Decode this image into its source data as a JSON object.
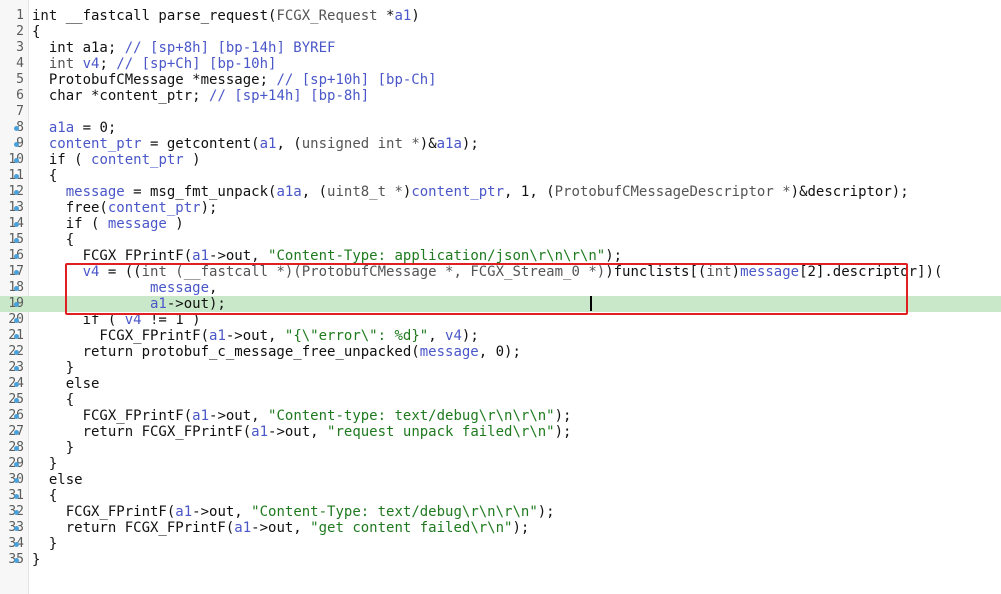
{
  "editor": {
    "highlighted_line": 19,
    "breakpoint_lines": [
      8,
      9,
      10,
      11,
      12,
      13,
      14,
      15,
      16,
      17,
      18,
      19,
      20,
      21,
      22,
      23,
      24,
      25,
      26,
      27,
      28,
      29,
      30,
      31,
      32,
      33,
      34,
      35
    ],
    "lines": [
      {
        "n": "1",
        "tokens": [
          [
            "kw",
            "int "
          ],
          [
            "txt",
            "__fastcall parse_request("
          ],
          [
            "type",
            "FCGX_Request"
          ],
          [
            "txt",
            " *"
          ],
          [
            "var",
            "a1"
          ],
          [
            "txt",
            ")"
          ]
        ]
      },
      {
        "n": "2",
        "tokens": [
          [
            "txt",
            "{"
          ]
        ]
      },
      {
        "n": "3",
        "tokens": [
          [
            "txt",
            "  int "
          ],
          [
            "txt",
            "a1a"
          ],
          [
            "txt",
            "; "
          ],
          [
            "cm",
            "// [sp+8h] [bp-14h] BYREF"
          ]
        ]
      },
      {
        "n": "4",
        "tokens": [
          [
            "type",
            "  int "
          ],
          [
            "var",
            "v4"
          ],
          [
            "txt",
            "; "
          ],
          [
            "cm",
            "// [sp+Ch] [bp-10h]"
          ]
        ]
      },
      {
        "n": "5",
        "tokens": [
          [
            "txt",
            "  ProtobufCMessage *message; "
          ],
          [
            "cm",
            "// [sp+10h] [bp-Ch]"
          ]
        ]
      },
      {
        "n": "6",
        "tokens": [
          [
            "txt",
            "  char *content_ptr; "
          ],
          [
            "cm",
            "// [sp+14h] [bp-8h]"
          ]
        ]
      },
      {
        "n": "7",
        "tokens": [
          [
            "txt",
            ""
          ]
        ]
      },
      {
        "n": "8",
        "tokens": [
          [
            "var",
            "  a1a"
          ],
          [
            "txt",
            " = 0;"
          ]
        ]
      },
      {
        "n": "9",
        "tokens": [
          [
            "var",
            "  content_ptr"
          ],
          [
            "txt",
            " = getcontent("
          ],
          [
            "var",
            "a1"
          ],
          [
            "txt",
            ", ("
          ],
          [
            "type",
            "unsigned int *"
          ],
          [
            "txt",
            ")&"
          ],
          [
            "var",
            "a1a"
          ],
          [
            "txt",
            ");"
          ]
        ]
      },
      {
        "n": "10",
        "tokens": [
          [
            "txt",
            "  if ( "
          ],
          [
            "var",
            "content_ptr"
          ],
          [
            "txt",
            " )"
          ]
        ]
      },
      {
        "n": "11",
        "tokens": [
          [
            "txt",
            "  {"
          ]
        ]
      },
      {
        "n": "12",
        "tokens": [
          [
            "var",
            "    message"
          ],
          [
            "txt",
            " = msg_fmt_unpack("
          ],
          [
            "var",
            "a1a"
          ],
          [
            "txt",
            ", ("
          ],
          [
            "type",
            "uint8_t *"
          ],
          [
            "txt",
            ")"
          ],
          [
            "var",
            "content_ptr"
          ],
          [
            "txt",
            ", 1, ("
          ],
          [
            "type",
            "ProtobufCMessageDescriptor *"
          ],
          [
            "txt",
            ")&descriptor);"
          ]
        ]
      },
      {
        "n": "13",
        "tokens": [
          [
            "txt",
            "    free("
          ],
          [
            "var",
            "content_ptr"
          ],
          [
            "txt",
            ");"
          ]
        ]
      },
      {
        "n": "14",
        "tokens": [
          [
            "txt",
            "    if ( "
          ],
          [
            "var",
            "message"
          ],
          [
            "txt",
            " )"
          ]
        ]
      },
      {
        "n": "15",
        "tokens": [
          [
            "txt",
            "    {"
          ]
        ]
      },
      {
        "n": "16",
        "tokens": [
          [
            "txt",
            "      FCGX_FPrintF("
          ],
          [
            "var",
            "a1"
          ],
          [
            "txt",
            "->out, "
          ],
          [
            "str",
            "\"Content-Type: application/json\\r\\n\\r\\n\""
          ],
          [
            "txt",
            ");"
          ]
        ]
      },
      {
        "n": "17",
        "tokens": [
          [
            "var",
            "      v4"
          ],
          [
            "txt",
            " = (("
          ],
          [
            "type",
            "int (__fastcall *)(ProtobufCMessage *, FCGX_Stream_0 *)"
          ],
          [
            "txt",
            ")funclists[("
          ],
          [
            "type",
            "int"
          ],
          [
            "txt",
            ")"
          ],
          [
            "var",
            "message"
          ],
          [
            "txt",
            "[2].descriptor])("
          ]
        ]
      },
      {
        "n": "18",
        "tokens": [
          [
            "var",
            "              message"
          ],
          [
            "txt",
            ","
          ]
        ]
      },
      {
        "n": "19",
        "tokens": [
          [
            "var",
            "              a1"
          ],
          [
            "txt",
            "->out);"
          ]
        ]
      },
      {
        "n": "20",
        "tokens": [
          [
            "txt",
            "      if ( "
          ],
          [
            "var",
            "v4"
          ],
          [
            "txt",
            " != 1 )"
          ]
        ]
      },
      {
        "n": "21",
        "tokens": [
          [
            "txt",
            "        FCGX_FPrintF("
          ],
          [
            "var",
            "a1"
          ],
          [
            "txt",
            "->out, "
          ],
          [
            "str",
            "\"{\\\"error\\\": %d}\""
          ],
          [
            "txt",
            ", "
          ],
          [
            "var",
            "v4"
          ],
          [
            "txt",
            ");"
          ]
        ]
      },
      {
        "n": "22",
        "tokens": [
          [
            "txt",
            "      return protobuf_c_message_free_unpacked("
          ],
          [
            "var",
            "message"
          ],
          [
            "txt",
            ", 0);"
          ]
        ]
      },
      {
        "n": "23",
        "tokens": [
          [
            "txt",
            "    }"
          ]
        ]
      },
      {
        "n": "24",
        "tokens": [
          [
            "txt",
            "    else"
          ]
        ]
      },
      {
        "n": "25",
        "tokens": [
          [
            "txt",
            "    {"
          ]
        ]
      },
      {
        "n": "26",
        "tokens": [
          [
            "txt",
            "      FCGX_FPrintF("
          ],
          [
            "var",
            "a1"
          ],
          [
            "txt",
            "->out, "
          ],
          [
            "str",
            "\"Content-type: text/debug\\r\\n\\r\\n\""
          ],
          [
            "txt",
            ");"
          ]
        ]
      },
      {
        "n": "27",
        "tokens": [
          [
            "txt",
            "      return FCGX_FPrintF("
          ],
          [
            "var",
            "a1"
          ],
          [
            "txt",
            "->out, "
          ],
          [
            "str",
            "\"request unpack failed\\r\\n\""
          ],
          [
            "txt",
            ");"
          ]
        ]
      },
      {
        "n": "28",
        "tokens": [
          [
            "txt",
            "    }"
          ]
        ]
      },
      {
        "n": "29",
        "tokens": [
          [
            "txt",
            "  }"
          ]
        ]
      },
      {
        "n": "30",
        "tokens": [
          [
            "txt",
            "  else"
          ]
        ]
      },
      {
        "n": "31",
        "tokens": [
          [
            "txt",
            "  {"
          ]
        ]
      },
      {
        "n": "32",
        "tokens": [
          [
            "txt",
            "    FCGX_FPrintF("
          ],
          [
            "var",
            "a1"
          ],
          [
            "txt",
            "->out, "
          ],
          [
            "str",
            "\"Content-Type: text/debug\\r\\n\\r\\n\""
          ],
          [
            "txt",
            ");"
          ]
        ]
      },
      {
        "n": "33",
        "tokens": [
          [
            "txt",
            "    return FCGX_FPrintF("
          ],
          [
            "var",
            "a1"
          ],
          [
            "txt",
            "->out, "
          ],
          [
            "str",
            "\"get content failed\\r\\n\""
          ],
          [
            "txt",
            ");"
          ]
        ]
      },
      {
        "n": "34",
        "tokens": [
          [
            "txt",
            "  }"
          ]
        ]
      },
      {
        "n": "35",
        "tokens": [
          [
            "txt",
            "}"
          ]
        ]
      }
    ]
  },
  "colors": {
    "highlight": "#c9e7c9",
    "annotation_box": "#e02020",
    "variable": "#4a57c8",
    "string": "#1f7a1f",
    "breakpoint_dot": "#4aa0d8"
  }
}
